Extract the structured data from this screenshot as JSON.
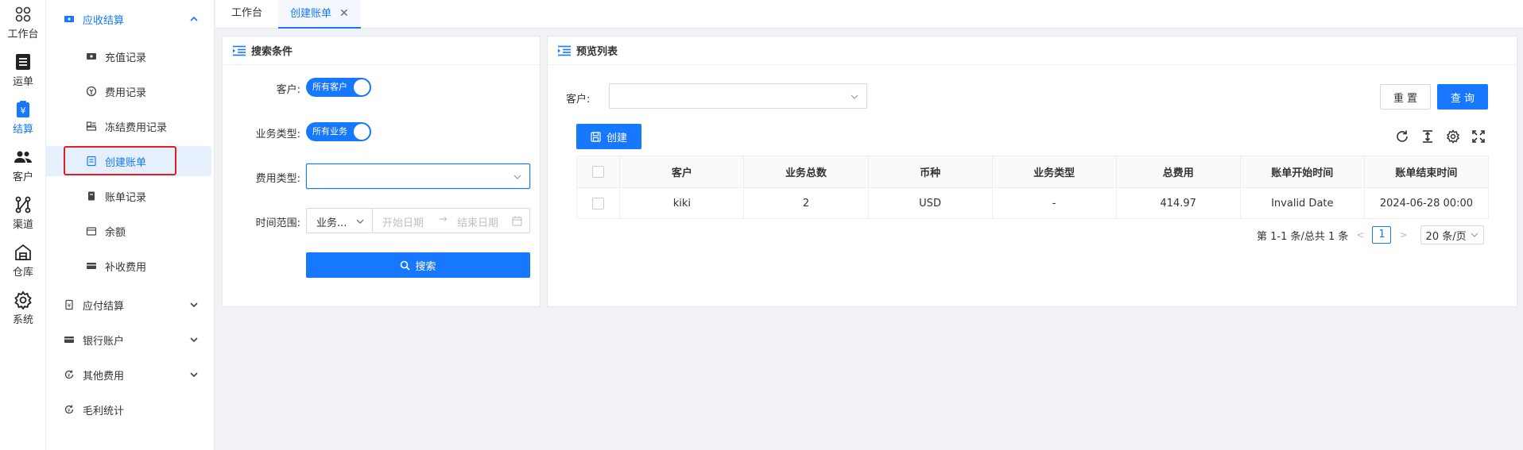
{
  "rail": [
    {
      "label": "工作台",
      "icon": "workbench-icon"
    },
    {
      "label": "运单",
      "icon": "list-icon"
    },
    {
      "label": "结算",
      "icon": "settlement-icon",
      "active": true
    },
    {
      "label": "客户",
      "icon": "users-icon"
    },
    {
      "label": "渠道",
      "icon": "channel-icon"
    },
    {
      "label": "仓库",
      "icon": "warehouse-icon"
    },
    {
      "label": "系统",
      "icon": "gear-icon"
    }
  ],
  "sidebar": {
    "group_receivable": "应收结算",
    "sub_items": [
      "充值记录",
      "费用记录",
      "冻结费用记录",
      "创建账单",
      "账单记录",
      "余额",
      "补收费用"
    ],
    "group_payable": "应付结算",
    "group_bank": "银行账户",
    "group_other": "其他费用",
    "gross_profit": "毛利统计"
  },
  "tabs": {
    "workbench": "工作台",
    "create_bill": "创建账单",
    "close": "✕"
  },
  "search_panel": {
    "title": "搜索条件",
    "customer_label": "客户:",
    "customer_switch": "所有客户",
    "biz_type_label": "业务类型:",
    "biz_type_switch": "所有业务",
    "fee_type_label": "费用类型:",
    "time_range_label": "时间范围:",
    "time_range_select": "业务...",
    "start_placeholder": "开始日期",
    "arrow": "→",
    "end_placeholder": "结束日期",
    "search_button": "搜索"
  },
  "preview_panel": {
    "title": "预览列表",
    "customer_label": "客户:",
    "reset_button": "重 置",
    "query_button": "查 询",
    "create_button": "创建",
    "columns": [
      "客户",
      "业务总数",
      "币种",
      "业务类型",
      "总费用",
      "账单开始时间",
      "账单结束时间"
    ],
    "rows": [
      {
        "customer": "kiki",
        "biz_count": "2",
        "currency": "USD",
        "biz_type": "-",
        "total_fee": "414.97",
        "start_time": "Invalid Date",
        "end_time": "2024-06-28 00:00"
      }
    ],
    "pagination": {
      "summary": "第 1-1 条/总共 1 条",
      "prev": "<",
      "page": "1",
      "next": ">",
      "page_size": "20 条/页"
    }
  },
  "colors": {
    "primary": "#1677ff",
    "highlight": "#e02020"
  }
}
